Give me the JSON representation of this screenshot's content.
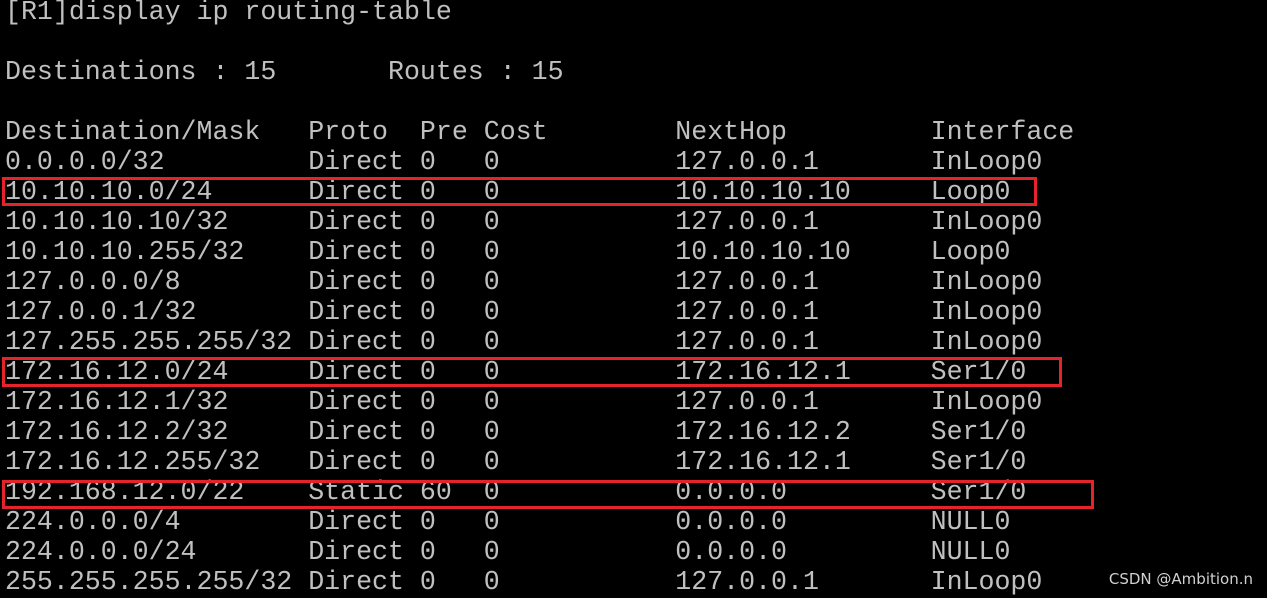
{
  "terminal": {
    "command": "[R1]display ip routing-table",
    "summary": "Destinations : 15       Routes : 15",
    "header": "Destination/Mask   Proto  Pre Cost        NextHop         Interface",
    "rows": [
      "0.0.0.0/32         Direct 0   0           127.0.0.1       InLoop0",
      "10.10.10.0/24      Direct 0   0           10.10.10.10     Loop0",
      "10.10.10.10/32     Direct 0   0           127.0.0.1       InLoop0",
      "10.10.10.255/32    Direct 0   0           10.10.10.10     Loop0",
      "127.0.0.0/8        Direct 0   0           127.0.0.1       InLoop0",
      "127.0.0.1/32       Direct 0   0           127.0.0.1       InLoop0",
      "127.255.255.255/32 Direct 0   0           127.0.0.1       InLoop0",
      "172.16.12.0/24     Direct 0   0           172.16.12.1     Ser1/0",
      "172.16.12.1/32     Direct 0   0           127.0.0.1       InLoop0",
      "172.16.12.2/32     Direct 0   0           172.16.12.2     Ser1/0",
      "172.16.12.255/32   Direct 0   0           172.16.12.1     Ser1/0",
      "192.168.12.0/22    Static 60  0           0.0.0.0         Ser1/0",
      "224.0.0.0/4        Direct 0   0           0.0.0.0         NULL0",
      "224.0.0.0/24       Direct 0   0           0.0.0.0         NULL0",
      "255.255.255.255/32 Direct 0   0           127.0.0.1       InLoop0"
    ]
  },
  "watermark": "CSDN @Ambition.n",
  "colors": {
    "background": "#000000",
    "text": "#c0c0c0",
    "highlight": "#e3242b"
  }
}
